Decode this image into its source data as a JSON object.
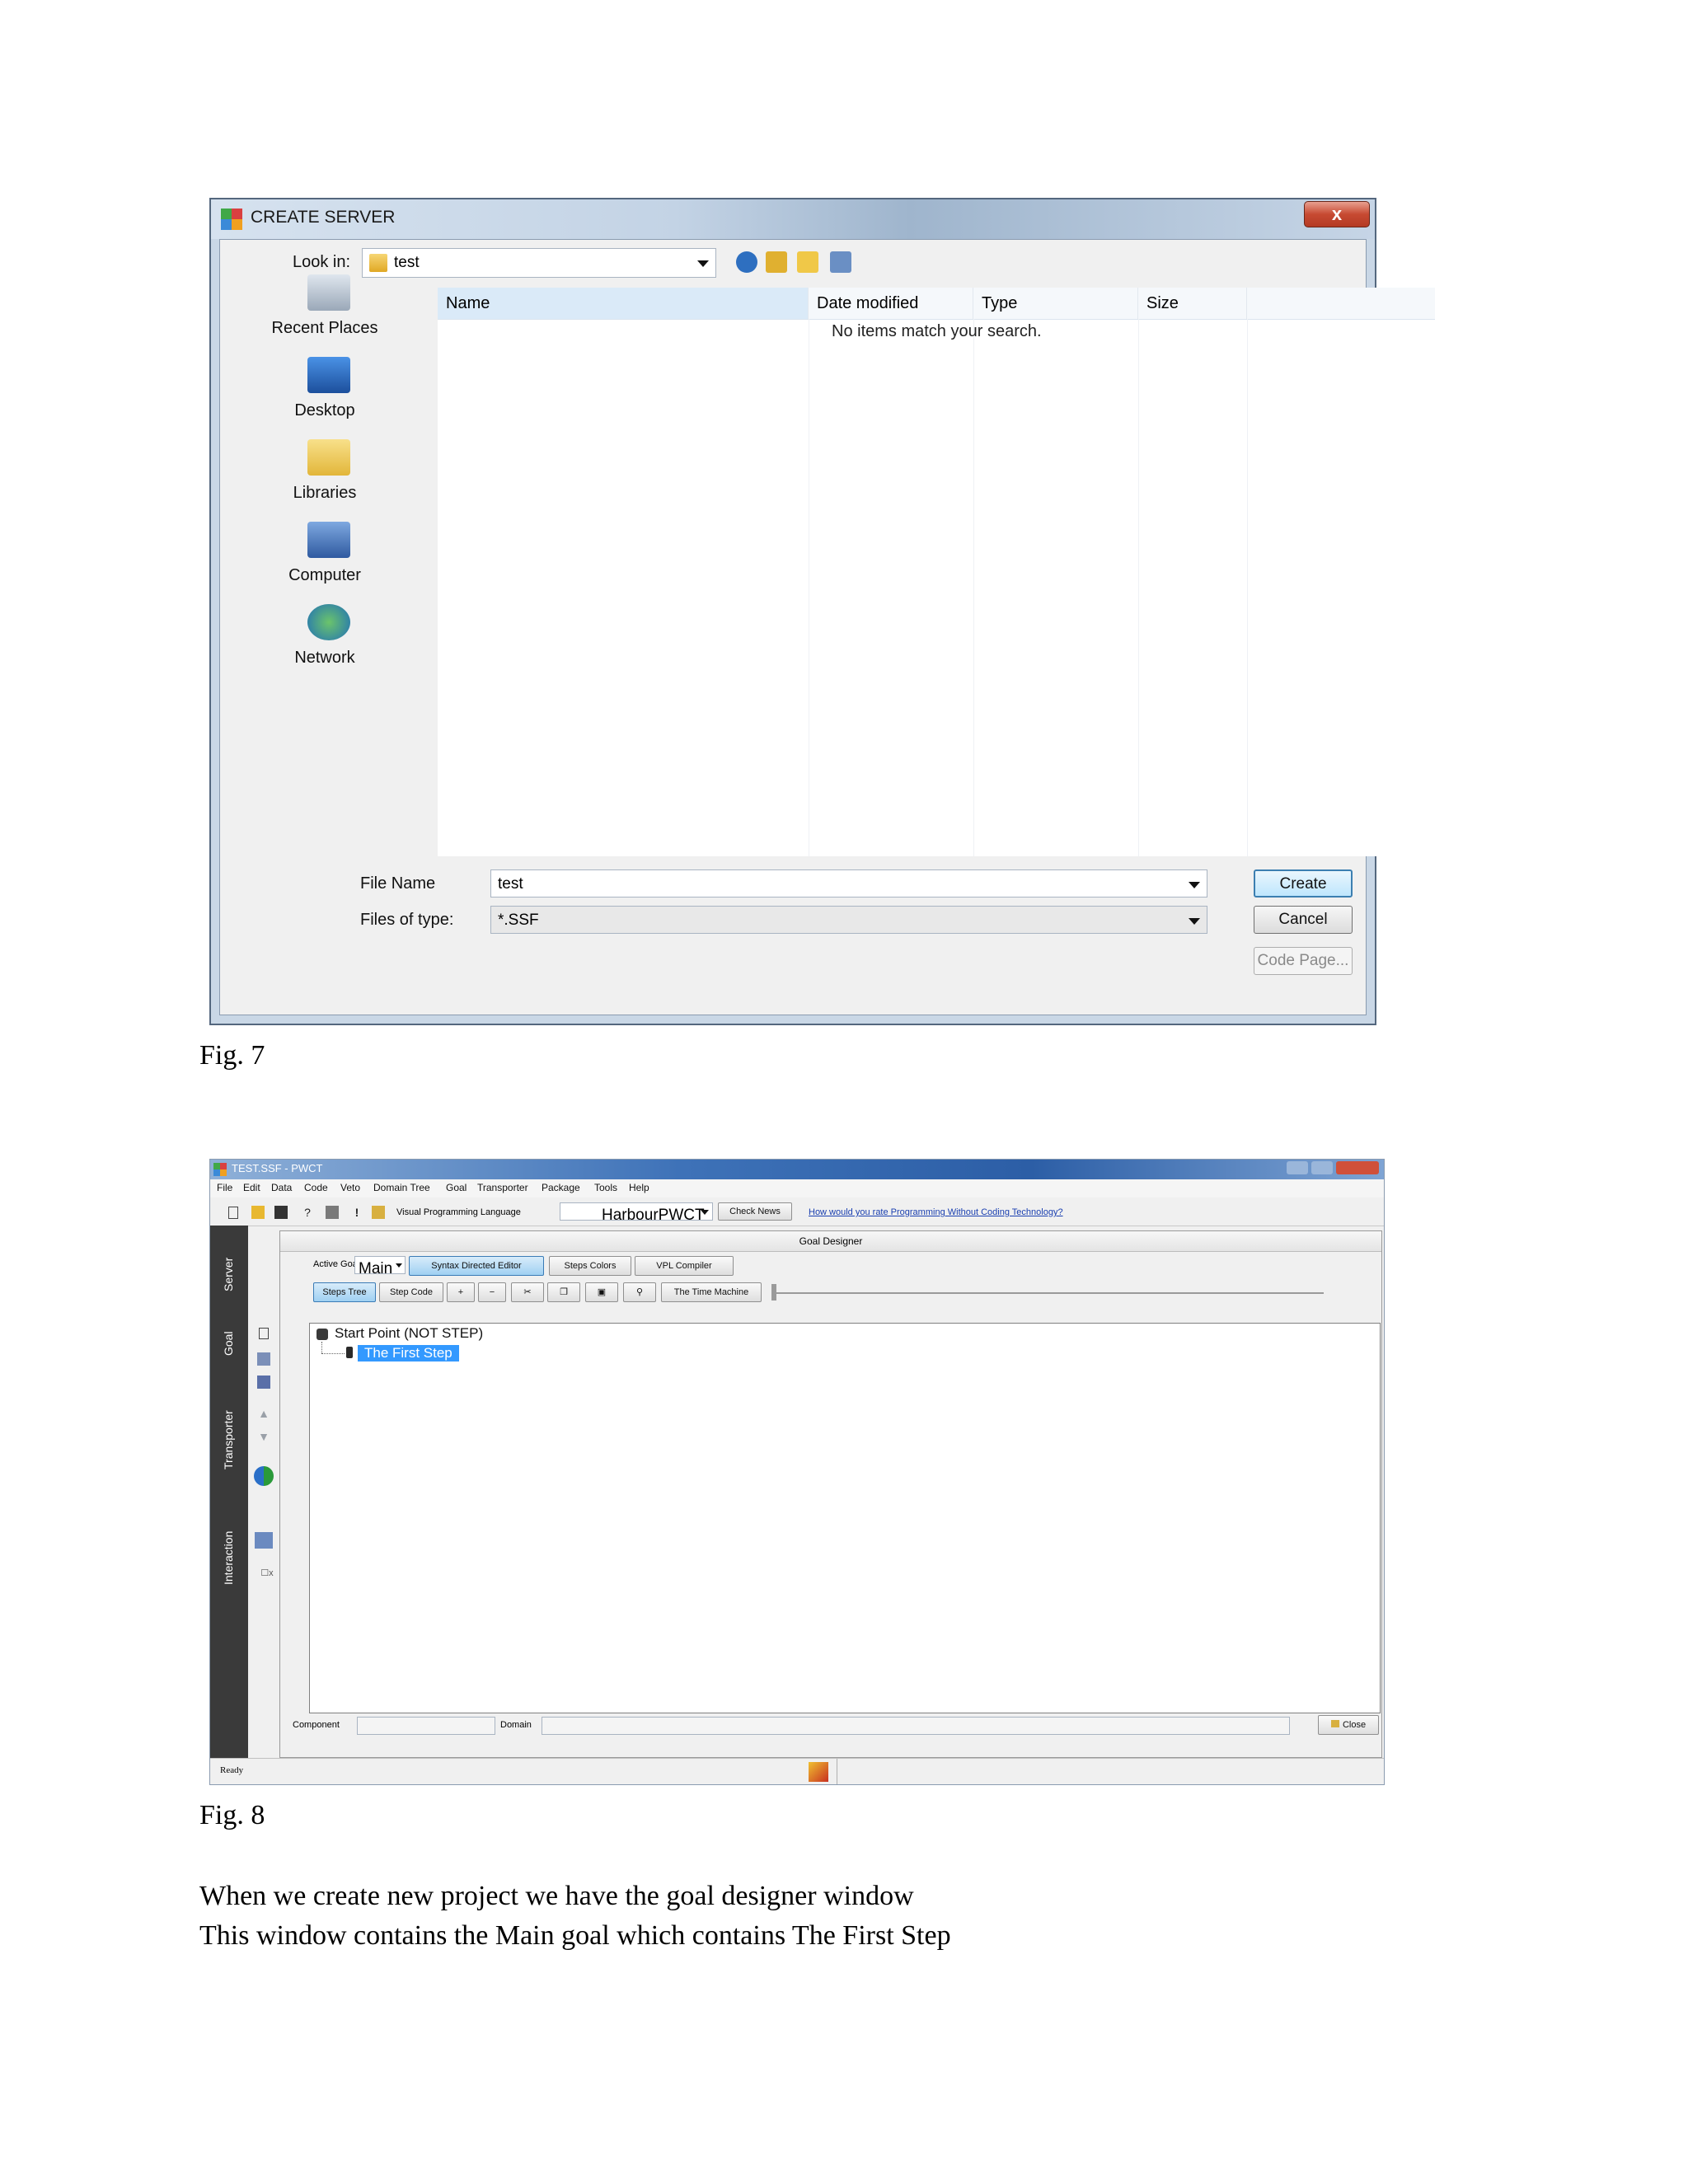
{
  "fig7": {
    "dialog_title": "CREATE SERVER",
    "close_label": "x",
    "look_in_label": "Look in:",
    "look_in_value": "test",
    "places": [
      "Recent Places",
      "Desktop",
      "Libraries",
      "Computer",
      "Network"
    ],
    "columns": [
      "Name",
      "Date modified",
      "Type",
      "Size"
    ],
    "empty_message": "No items match your search.",
    "file_name_label": "File Name",
    "file_name_value": "test",
    "file_type_label": "Files of type:",
    "file_type_value": "*.SSF",
    "buttons": {
      "create": "Create",
      "cancel": "Cancel",
      "code_page": "Code Page..."
    },
    "caption": "Fig. 7"
  },
  "fig8": {
    "window_title": "TEST.SSF - PWCT",
    "menu": [
      "File",
      "Edit",
      "Data",
      "Code",
      "Veto",
      "Domain Tree",
      "Goal",
      "Transporter",
      "Package",
      "Tools",
      "Help"
    ],
    "vpl_label": "Visual Programming Language",
    "vpl_value": "HarbourPWCT",
    "check_news": "Check News",
    "rate_link": "How would you rate Programming Without Coding Technology?",
    "vertical_tabs": [
      "Server",
      "Goal",
      "Transporter",
      "Interaction"
    ],
    "panel_title": "Goal Designer",
    "active_goal_label": "Active Goal :",
    "active_goal_value": "Main",
    "buttons_row1": [
      "Syntax Directed Editor",
      "Steps Colors",
      "VPL Compiler"
    ],
    "buttons_row2": [
      "Steps Tree",
      "Step Code"
    ],
    "time_machine": "The Time Machine",
    "tree": {
      "root": "Start Point (NOT STEP)",
      "child": "The First Step"
    },
    "component_label": "Component",
    "domain_label": "Domain",
    "close_button": "Close",
    "status": "Ready",
    "caption": "Fig. 8"
  },
  "body_text": [
    "When we create new project we have the goal designer window",
    "This window contains the Main goal which contains The First Step"
  ]
}
